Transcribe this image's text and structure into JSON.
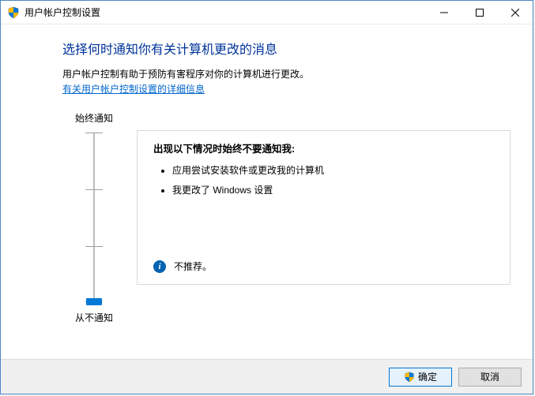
{
  "window": {
    "title": "用户帐户控制设置"
  },
  "heading": "选择何时通知你有关计算机更改的消息",
  "description": "用户帐户控制有助于预防有害程序对你的计算机进行更改。",
  "link_text": "有关用户帐户控制设置的详细信息",
  "slider": {
    "top_label": "始终通知",
    "bottom_label": "从不通知",
    "levels": 4,
    "current_level": 0
  },
  "info": {
    "title": "出现以下情况时始终不要通知我:",
    "bullets": [
      "应用尝试安装软件或更改我的计算机",
      "我更改了 Windows 设置"
    ],
    "recommend": "不推荐。"
  },
  "buttons": {
    "ok": "确定",
    "cancel": "取消"
  },
  "icons": {
    "shield": "uac-shield-icon",
    "info": "i"
  }
}
